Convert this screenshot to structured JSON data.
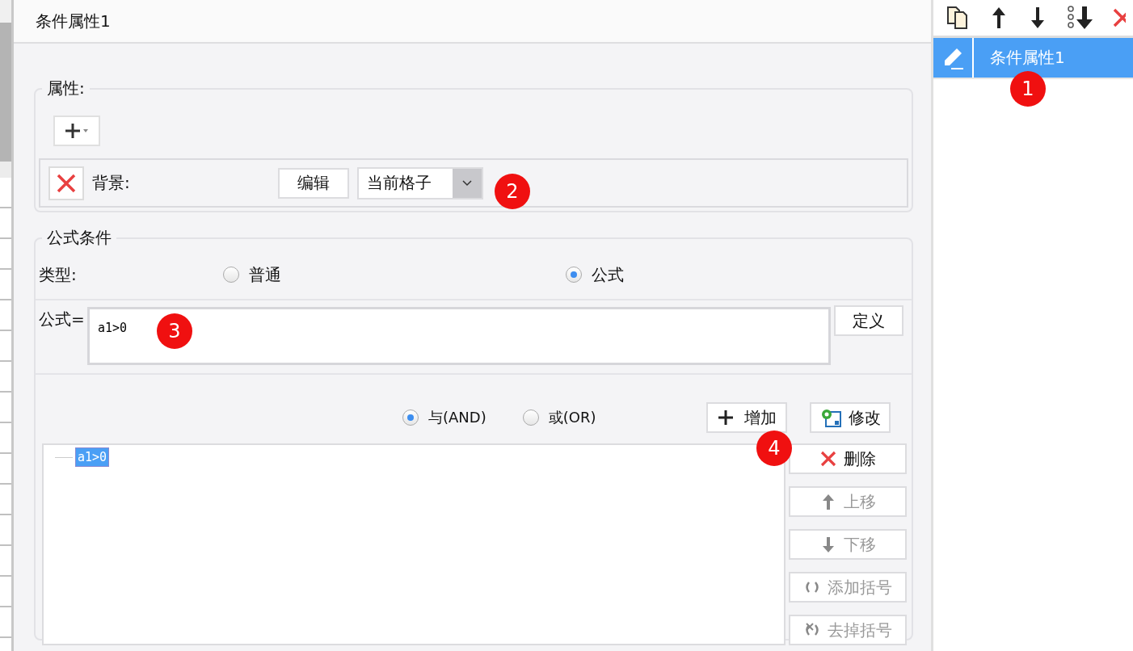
{
  "header": {
    "title": "条件属性1"
  },
  "properties": {
    "legend": "属性:",
    "rows": [
      {
        "label": "背景:",
        "edit_button": "编辑",
        "dropdown": {
          "value": "当前格子"
        }
      }
    ]
  },
  "condition": {
    "legend": "公式条件",
    "type_label": "类型:",
    "type_options": [
      {
        "label": "普通",
        "selected": false
      },
      {
        "label": "公式",
        "selected": true
      }
    ],
    "formula_label": "公式=",
    "formula": {
      "value": "a1>0"
    },
    "define_button": "定义",
    "logic_options": [
      {
        "label": "与(AND)",
        "selected": true
      },
      {
        "label": "或(OR)",
        "selected": false
      }
    ],
    "add_button": "增加",
    "modify_button": "修改",
    "tree": [
      {
        "label": "a1>0",
        "selected": true
      }
    ],
    "side_buttons": [
      {
        "kind": "delete",
        "label": "删除",
        "disabled": false
      },
      {
        "kind": "up",
        "label": "上移",
        "disabled": true
      },
      {
        "kind": "down",
        "label": "下移",
        "disabled": true
      },
      {
        "kind": "add-paren",
        "label": "添加括号",
        "disabled": true
      },
      {
        "kind": "remove-paren",
        "label": "去掉括号",
        "disabled": true
      }
    ]
  },
  "list_panel": {
    "items": [
      {
        "label": "条件属性1",
        "selected": true
      }
    ]
  },
  "annotations": [
    {
      "label": "1"
    },
    {
      "label": "2"
    },
    {
      "label": "3"
    },
    {
      "label": "4"
    }
  ]
}
